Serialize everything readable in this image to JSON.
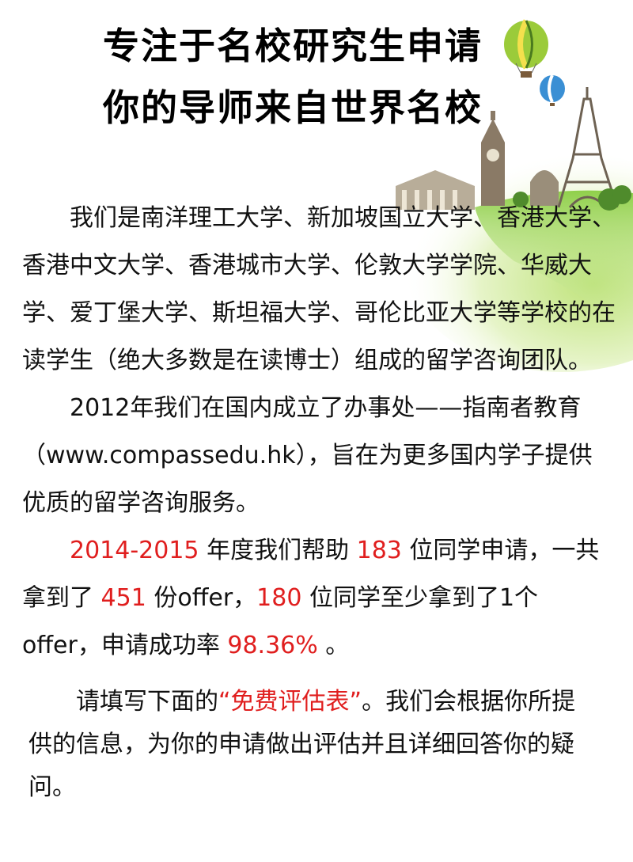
{
  "header": {
    "title_line1": "专注于名校研究生申请",
    "title_line2": "你的导师来自世界名校"
  },
  "intro": {
    "p1": "我们是南洋理工大学、新加坡国立大学、香港大学、香港中文大学、香港城市大学、伦敦大学学院、华威大学、爱丁堡大学、斯坦福大学、哥伦比亚大学等学校的在读学生（绝大多数是在读博士）组成的留学咨询团队。",
    "p2": "2012年我们在国内成立了办事处——指南者教育（www.compassedu.hk），旨在为更多国内学子提供优质的留学咨询服务。"
  },
  "stats": {
    "year": "2014-2015",
    "t1": " 年度我们帮助 ",
    "students_helped": "183",
    "t2": " 位同学申请，一共拿到了 ",
    "offers": "451",
    "t3": " 份offer，",
    "students_with_offer": "180",
    "t4": " 位同学至少拿到了1个offer，申请成功率 ",
    "success_rate": "98.36%",
    "t5": " 。"
  },
  "cta": {
    "pre": "请填写下面的",
    "form_name": "“免费评估表”",
    "post": "。我们会根据你所提供的信息，为你的申请做出评估并且详细回答你的疑问。"
  },
  "colors": {
    "highlight": "#e01e1e",
    "grass": "#7cc242"
  },
  "icons": [
    "hot-air-balloon-icon",
    "eiffel-tower-icon",
    "big-ben-icon"
  ]
}
